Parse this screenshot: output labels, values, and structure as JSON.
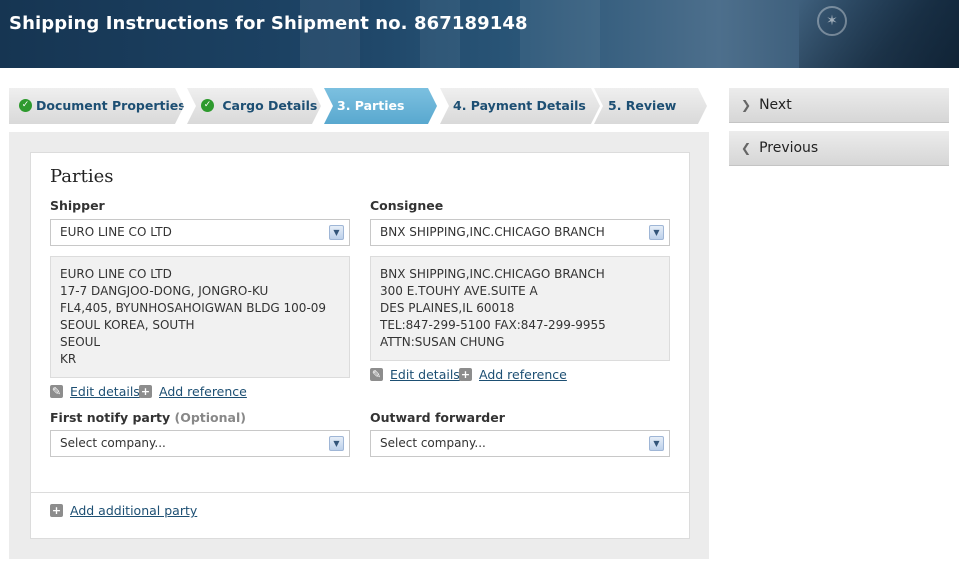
{
  "header": {
    "title": "Shipping Instructions for Shipment no. 867189148"
  },
  "steps": [
    {
      "label": "Document Properties",
      "state": "done"
    },
    {
      "label": "Cargo Details",
      "state": "done"
    },
    {
      "label": "3.  Parties",
      "state": "active"
    },
    {
      "label": "4.  Payment Details",
      "state": "pending"
    },
    {
      "label": "5.  Review",
      "state": "pending"
    }
  ],
  "nav": {
    "next_label": "Next",
    "previous_label": "Previous"
  },
  "section": {
    "title": "Parties"
  },
  "shipper": {
    "label": "Shipper",
    "selected": "EURO LINE CO LTD",
    "address_lines": [
      "EURO LINE CO LTD",
      "17-7 DANGJOO-DONG, JONGRO-KU",
      "FL4,405, BYUNHOSAHOIGWAN BLDG 100-09",
      "SEOUL KOREA, SOUTH",
      "SEOUL",
      "KR"
    ],
    "edit_label": "Edit details",
    "add_ref_label": "Add reference"
  },
  "consignee": {
    "label": "Consignee",
    "selected": "BNX SHIPPING,INC.CHICAGO BRANCH",
    "address_lines": [
      "BNX SHIPPING,INC.CHICAGO BRANCH",
      "300 E.TOUHY AVE.SUITE A",
      "DES PLAINES,IL 60018",
      "TEL:847-299-5100 FAX:847-299-9955",
      "ATTN:SUSAN CHUNG"
    ],
    "edit_label": "Edit details",
    "add_ref_label": "Add reference"
  },
  "first_notify": {
    "label": "First notify party",
    "optional": "(Optional)",
    "placeholder": "Select company..."
  },
  "outward_forwarder": {
    "label": "Outward forwarder",
    "placeholder": "Select company..."
  },
  "add_party_label": "Add additional party",
  "colors": {
    "accent": "#1d4f73",
    "active_step": "#6bb6da",
    "check": "#2e9a2e"
  }
}
